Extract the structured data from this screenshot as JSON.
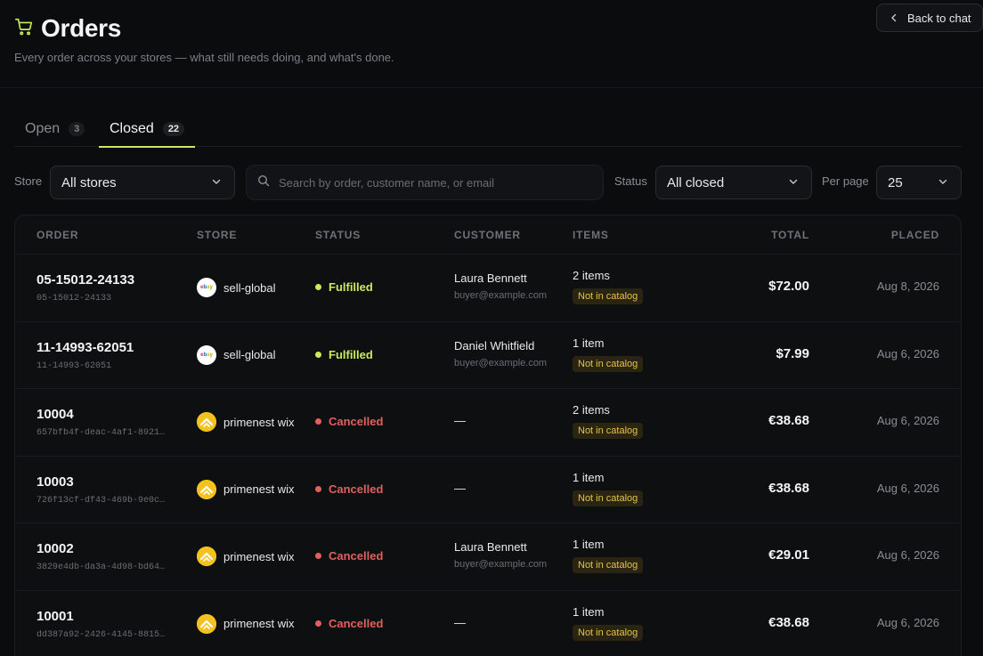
{
  "header": {
    "title": "Orders",
    "subtitle": "Every order across your stores — what still needs doing, and what's done.",
    "back_label": "Back to chat"
  },
  "tabs": [
    {
      "label": "Open",
      "count": "3",
      "active": false
    },
    {
      "label": "Closed",
      "count": "22",
      "active": true
    }
  ],
  "filters": {
    "store_label": "Store",
    "store_value": "All stores",
    "search_placeholder": "Search by order, customer name, or email",
    "status_label": "Status",
    "status_value": "All closed",
    "per_page_label": "Per page",
    "per_page_value": "25"
  },
  "table": {
    "columns": [
      "ORDER",
      "STORE",
      "STATUS",
      "CUSTOMER",
      "ITEMS",
      "TOTAL",
      "PLACED"
    ],
    "rows": [
      {
        "order": "05-15012-24133",
        "sub": "05-15012-24133",
        "store": "sell-global",
        "store_logo": "ebay",
        "status": "Fulfilled",
        "customer_name": "Laura Bennett",
        "customer_email": "buyer@example.com",
        "items": "2 items",
        "badge": "Not in catalog",
        "total": "$72.00",
        "placed": "Aug 8, 2026"
      },
      {
        "order": "11-14993-62051",
        "sub": "11-14993-62051",
        "store": "sell-global",
        "store_logo": "ebay",
        "status": "Fulfilled",
        "customer_name": "Daniel Whitfield",
        "customer_email": "buyer@example.com",
        "items": "1 item",
        "badge": "Not in catalog",
        "total": "$7.99",
        "placed": "Aug 6, 2026"
      },
      {
        "order": "10004",
        "sub": "657bfb4f-deac-4af1-8921…",
        "store": "primenest wix",
        "store_logo": "wix",
        "status": "Cancelled",
        "customer_name": "—",
        "customer_email": "",
        "items": "2 items",
        "badge": "Not in catalog",
        "total": "€38.68",
        "placed": "Aug 6, 2026"
      },
      {
        "order": "10003",
        "sub": "726f13cf-df43-469b-9e0c…",
        "store": "primenest wix",
        "store_logo": "wix",
        "status": "Cancelled",
        "customer_name": "—",
        "customer_email": "",
        "items": "1 item",
        "badge": "Not in catalog",
        "total": "€38.68",
        "placed": "Aug 6, 2026"
      },
      {
        "order": "10002",
        "sub": "3829e4db-da3a-4d98-bd64…",
        "store": "primenest wix",
        "store_logo": "wix",
        "status": "Cancelled",
        "customer_name": "Laura Bennett",
        "customer_email": "buyer@example.com",
        "items": "1 item",
        "badge": "Not in catalog",
        "total": "€29.01",
        "placed": "Aug 6, 2026"
      },
      {
        "order": "10001",
        "sub": "dd387a92-2426-4145-8815…",
        "store": "primenest wix",
        "store_logo": "wix",
        "status": "Cancelled",
        "customer_name": "—",
        "customer_email": "",
        "items": "1 item",
        "badge": "Not in catalog",
        "total": "€38.68",
        "placed": "Aug 6, 2026"
      }
    ]
  },
  "icons": {
    "cart": "cart-icon",
    "back": "chevron-left-icon",
    "search": "search-icon",
    "dropdown": "chevron-down-icon"
  },
  "colors": {
    "accent": "#c9ea5a",
    "fulfilled": "#c9ea5a",
    "cancelled": "#e0605e",
    "badge_text": "#e6c34a",
    "badge_bg": "#2a2412"
  }
}
